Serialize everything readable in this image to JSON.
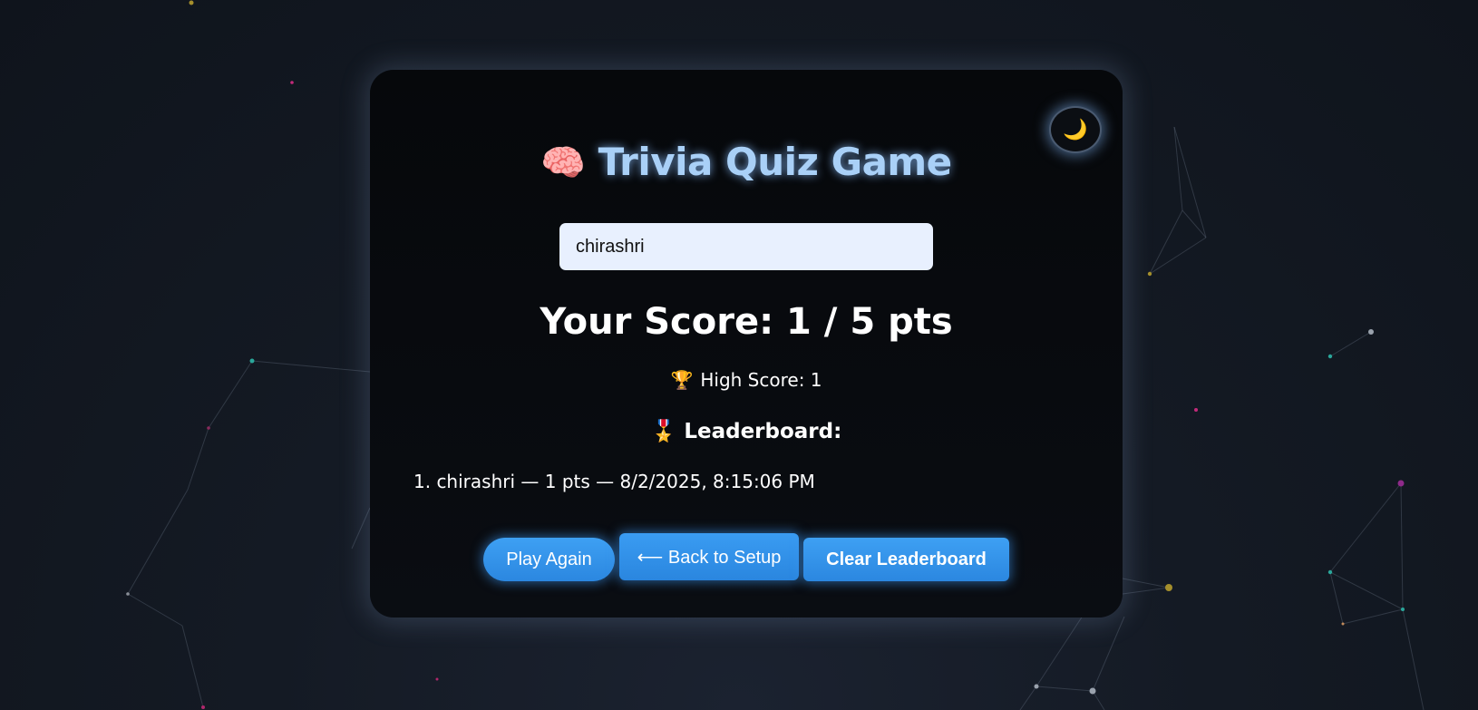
{
  "app": {
    "title": "Trivia Quiz Game",
    "title_icon": "🧠",
    "theme_toggle_icon": "🌙"
  },
  "player": {
    "name_value": "chirashri"
  },
  "score": {
    "text": "Your Score: 1 / 5 pts"
  },
  "high_score": {
    "icon": "🏆",
    "text": "High Score: 1"
  },
  "leaderboard": {
    "icon": "🎖️",
    "heading": "Leaderboard:",
    "entries": [
      "1. chirashri — 1 pts — 8/2/2025, 8:15:06 PM"
    ]
  },
  "buttons": {
    "play_again": "Play Again",
    "back_to_setup": "⟵ Back to Setup",
    "clear_leaderboard": "Clear Leaderboard"
  },
  "colors": {
    "accent": "#2b87e0",
    "title_glow": "#a9d0f7",
    "card_bg": "#06080b",
    "input_bg": "#e8f0fe"
  }
}
